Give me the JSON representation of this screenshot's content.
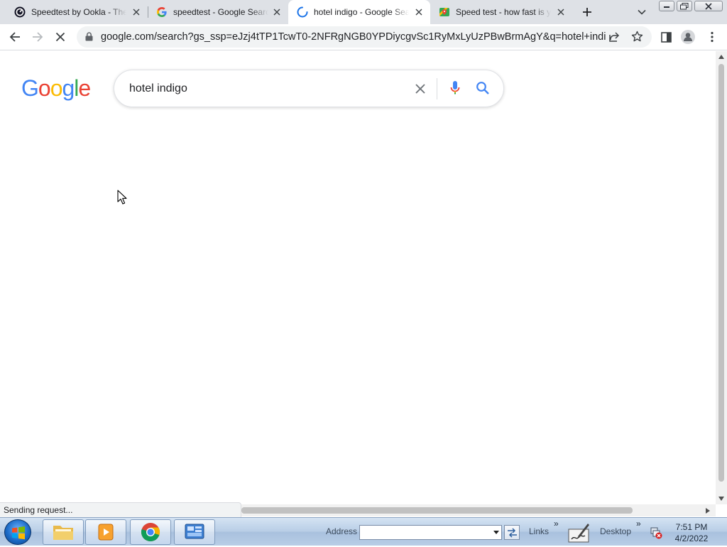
{
  "browser": {
    "tabs": [
      {
        "title": "Speedtest by Ookla - The Global Broadband Speed Test",
        "favicon": "ookla-icon",
        "active": false
      },
      {
        "title": "speedtest - Google Search",
        "favicon": "google-g-icon",
        "active": false
      },
      {
        "title": "hotel indigo - Google Search",
        "favicon": "loading-spinner-icon",
        "active": true
      },
      {
        "title": "Speed test - how fast is your internet",
        "favicon": "maps-pin-icon",
        "active": false
      }
    ],
    "url": "google.com/search?gs_ssp=eJzj4tTP1TcwT0-2NFRgNGB0YPDiycgvSc1RyMxLyUzPBwBrmAgY&q=hotel+indigo&r..."
  },
  "search": {
    "logo_text": "Google",
    "query": "hotel indigo"
  },
  "status_bar": {
    "text": "Sending request..."
  },
  "taskbar": {
    "address_label": "Address",
    "links_label": "Links",
    "desktop_label": "Desktop",
    "time": "7:51 PM",
    "date": "4/2/2022"
  },
  "colors": {
    "google_blue": "#4285F4",
    "google_red": "#EA4335",
    "google_yellow": "#FBBC05",
    "google_green": "#34A853",
    "tabstrip_bg": "#dee1e6"
  }
}
